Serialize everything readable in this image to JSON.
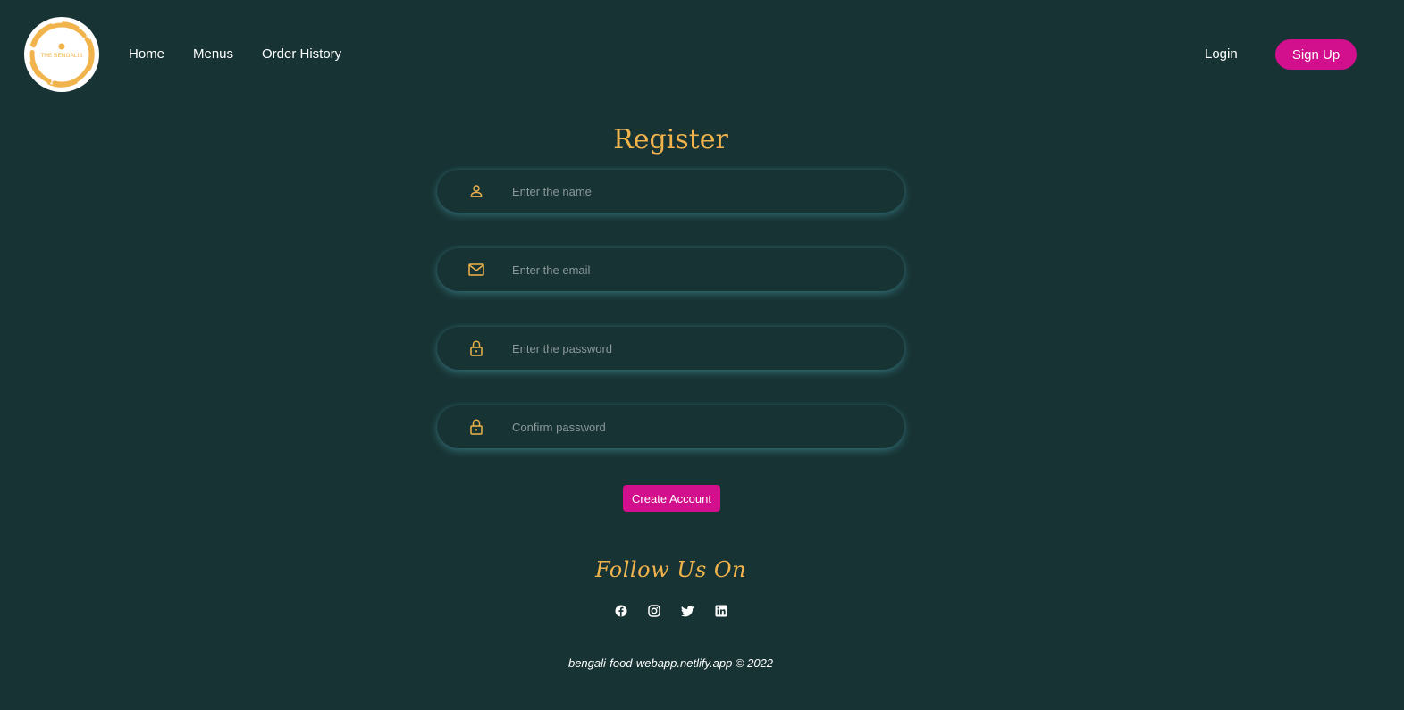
{
  "brand": {
    "logo_text": "THE BENGALIS",
    "accent": "#f1b34b",
    "primary": "#d20f8c",
    "background": "#183334"
  },
  "nav": {
    "items": [
      {
        "label": "Home"
      },
      {
        "label": "Menus"
      },
      {
        "label": "Order History"
      }
    ],
    "login_label": "Login",
    "signup_label": "Sign Up"
  },
  "form": {
    "title": "Register",
    "fields": [
      {
        "icon": "user-icon",
        "placeholder": "Enter the name",
        "value": ""
      },
      {
        "icon": "mail-icon",
        "placeholder": "Enter the email",
        "value": ""
      },
      {
        "icon": "lock-icon",
        "placeholder": "Enter the password",
        "value": ""
      },
      {
        "icon": "lock-icon",
        "placeholder": "Confirm password",
        "value": ""
      }
    ],
    "submit_label": "Create Account"
  },
  "footer": {
    "follow_title": "Follow Us On",
    "social": [
      {
        "icon": "facebook-icon"
      },
      {
        "icon": "instagram-icon"
      },
      {
        "icon": "twitter-icon"
      },
      {
        "icon": "linkedin-icon"
      }
    ],
    "copyright": "bengali-food-webapp.netlify.app © 2022"
  }
}
